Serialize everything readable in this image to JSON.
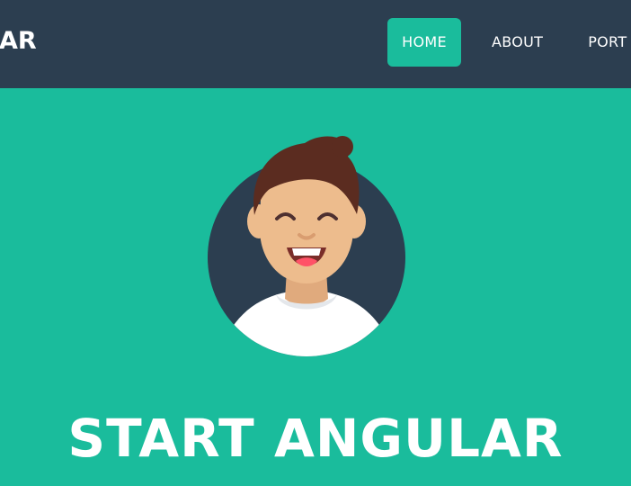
{
  "navbar": {
    "brand": "AR",
    "links": [
      {
        "label": "HOME",
        "active": true
      },
      {
        "label": "ABOUT",
        "active": false
      },
      {
        "label": "PORT",
        "active": false
      }
    ]
  },
  "hero": {
    "avatar_icon": "smiling-person-avatar",
    "title": "START ANGULAR"
  },
  "colors": {
    "navbar_bg": "#2c3e50",
    "accent": "#1abc9c",
    "text": "#ffffff"
  }
}
